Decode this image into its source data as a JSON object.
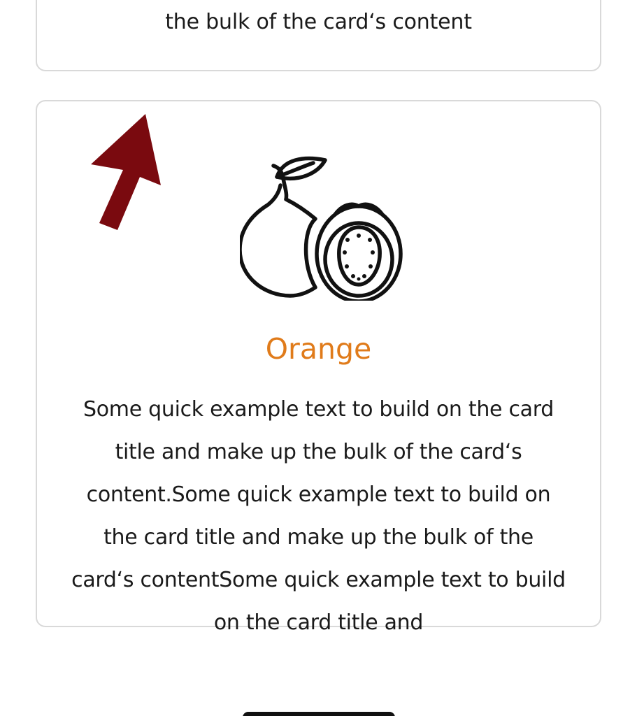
{
  "top_card": {
    "text_fragment": "the bulk of the card‘s content"
  },
  "main_card": {
    "icon": "guava-icon",
    "title": "Orange",
    "title_color": "#e07b1a",
    "body": "Some quick example text to build on the card title and make up the bulk of the card‘s content.Some quick example text to build on the card title and make up the bulk of the card‘s contentSome quick example text to build on the card title and"
  },
  "annotation": {
    "icon": "arrow-up-icon",
    "color": "#7a0a0f"
  }
}
